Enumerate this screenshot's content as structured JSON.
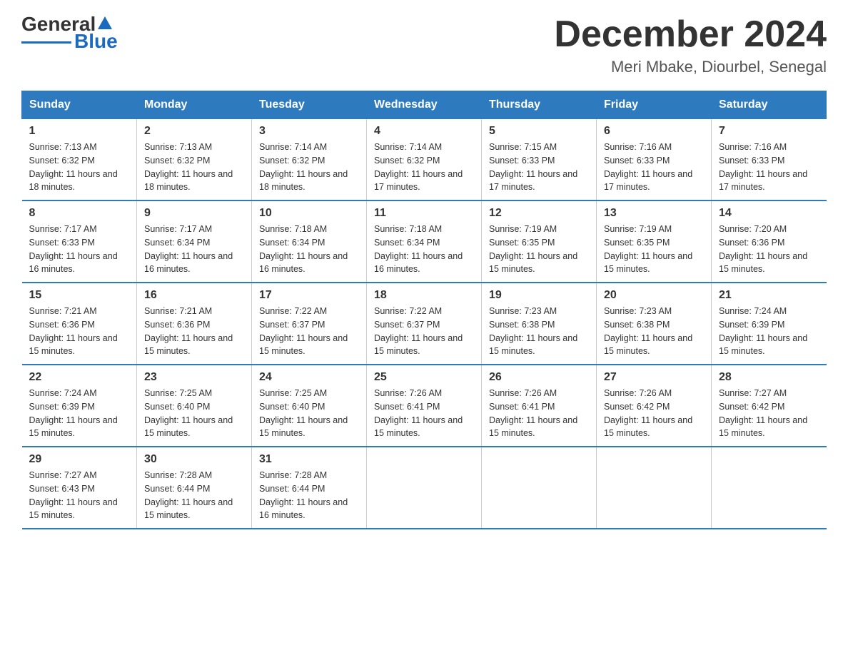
{
  "logo": {
    "text_general": "General",
    "text_blue": "Blue"
  },
  "title": {
    "month": "December 2024",
    "location": "Meri Mbake, Diourbel, Senegal"
  },
  "headers": [
    "Sunday",
    "Monday",
    "Tuesday",
    "Wednesday",
    "Thursday",
    "Friday",
    "Saturday"
  ],
  "weeks": [
    [
      {
        "day": "1",
        "sunrise": "7:13 AM",
        "sunset": "6:32 PM",
        "daylight": "11 hours and 18 minutes."
      },
      {
        "day": "2",
        "sunrise": "7:13 AM",
        "sunset": "6:32 PM",
        "daylight": "11 hours and 18 minutes."
      },
      {
        "day": "3",
        "sunrise": "7:14 AM",
        "sunset": "6:32 PM",
        "daylight": "11 hours and 18 minutes."
      },
      {
        "day": "4",
        "sunrise": "7:14 AM",
        "sunset": "6:32 PM",
        "daylight": "11 hours and 17 minutes."
      },
      {
        "day": "5",
        "sunrise": "7:15 AM",
        "sunset": "6:33 PM",
        "daylight": "11 hours and 17 minutes."
      },
      {
        "day": "6",
        "sunrise": "7:16 AM",
        "sunset": "6:33 PM",
        "daylight": "11 hours and 17 minutes."
      },
      {
        "day": "7",
        "sunrise": "7:16 AM",
        "sunset": "6:33 PM",
        "daylight": "11 hours and 17 minutes."
      }
    ],
    [
      {
        "day": "8",
        "sunrise": "7:17 AM",
        "sunset": "6:33 PM",
        "daylight": "11 hours and 16 minutes."
      },
      {
        "day": "9",
        "sunrise": "7:17 AM",
        "sunset": "6:34 PM",
        "daylight": "11 hours and 16 minutes."
      },
      {
        "day": "10",
        "sunrise": "7:18 AM",
        "sunset": "6:34 PM",
        "daylight": "11 hours and 16 minutes."
      },
      {
        "day": "11",
        "sunrise": "7:18 AM",
        "sunset": "6:34 PM",
        "daylight": "11 hours and 16 minutes."
      },
      {
        "day": "12",
        "sunrise": "7:19 AM",
        "sunset": "6:35 PM",
        "daylight": "11 hours and 15 minutes."
      },
      {
        "day": "13",
        "sunrise": "7:19 AM",
        "sunset": "6:35 PM",
        "daylight": "11 hours and 15 minutes."
      },
      {
        "day": "14",
        "sunrise": "7:20 AM",
        "sunset": "6:36 PM",
        "daylight": "11 hours and 15 minutes."
      }
    ],
    [
      {
        "day": "15",
        "sunrise": "7:21 AM",
        "sunset": "6:36 PM",
        "daylight": "11 hours and 15 minutes."
      },
      {
        "day": "16",
        "sunrise": "7:21 AM",
        "sunset": "6:36 PM",
        "daylight": "11 hours and 15 minutes."
      },
      {
        "day": "17",
        "sunrise": "7:22 AM",
        "sunset": "6:37 PM",
        "daylight": "11 hours and 15 minutes."
      },
      {
        "day": "18",
        "sunrise": "7:22 AM",
        "sunset": "6:37 PM",
        "daylight": "11 hours and 15 minutes."
      },
      {
        "day": "19",
        "sunrise": "7:23 AM",
        "sunset": "6:38 PM",
        "daylight": "11 hours and 15 minutes."
      },
      {
        "day": "20",
        "sunrise": "7:23 AM",
        "sunset": "6:38 PM",
        "daylight": "11 hours and 15 minutes."
      },
      {
        "day": "21",
        "sunrise": "7:24 AM",
        "sunset": "6:39 PM",
        "daylight": "11 hours and 15 minutes."
      }
    ],
    [
      {
        "day": "22",
        "sunrise": "7:24 AM",
        "sunset": "6:39 PM",
        "daylight": "11 hours and 15 minutes."
      },
      {
        "day": "23",
        "sunrise": "7:25 AM",
        "sunset": "6:40 PM",
        "daylight": "11 hours and 15 minutes."
      },
      {
        "day": "24",
        "sunrise": "7:25 AM",
        "sunset": "6:40 PM",
        "daylight": "11 hours and 15 minutes."
      },
      {
        "day": "25",
        "sunrise": "7:26 AM",
        "sunset": "6:41 PM",
        "daylight": "11 hours and 15 minutes."
      },
      {
        "day": "26",
        "sunrise": "7:26 AM",
        "sunset": "6:41 PM",
        "daylight": "11 hours and 15 minutes."
      },
      {
        "day": "27",
        "sunrise": "7:26 AM",
        "sunset": "6:42 PM",
        "daylight": "11 hours and 15 minutes."
      },
      {
        "day": "28",
        "sunrise": "7:27 AM",
        "sunset": "6:42 PM",
        "daylight": "11 hours and 15 minutes."
      }
    ],
    [
      {
        "day": "29",
        "sunrise": "7:27 AM",
        "sunset": "6:43 PM",
        "daylight": "11 hours and 15 minutes."
      },
      {
        "day": "30",
        "sunrise": "7:28 AM",
        "sunset": "6:44 PM",
        "daylight": "11 hours and 15 minutes."
      },
      {
        "day": "31",
        "sunrise": "7:28 AM",
        "sunset": "6:44 PM",
        "daylight": "11 hours and 16 minutes."
      },
      null,
      null,
      null,
      null
    ]
  ]
}
